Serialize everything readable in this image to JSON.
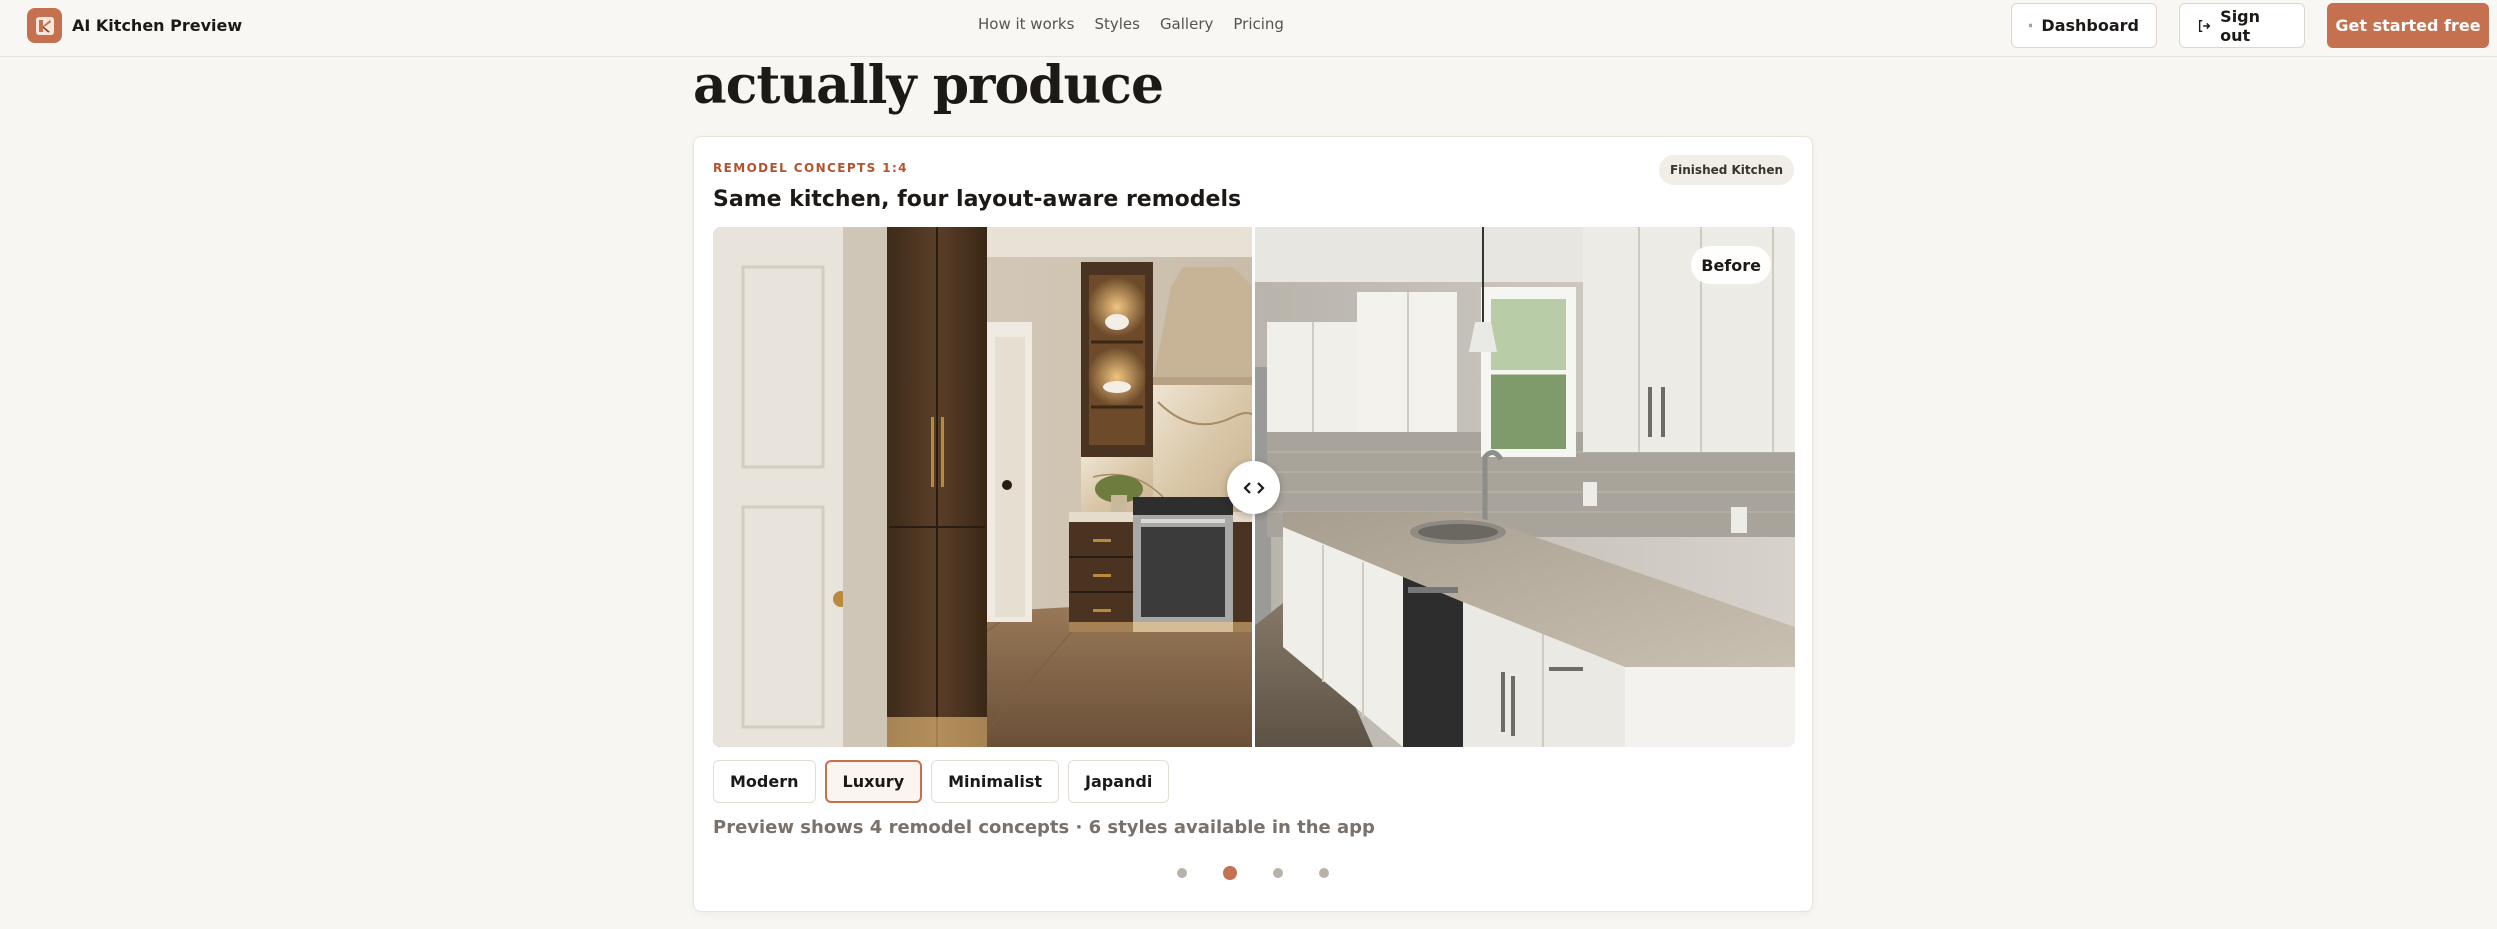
{
  "header": {
    "brand": "AI Kitchen Preview",
    "nav": [
      "How it works",
      "Styles",
      "Gallery",
      "Pricing"
    ],
    "dashboard_label": "Dashboard",
    "signout_label": "Sign out",
    "cta_label": "Get started free"
  },
  "hero": {
    "title": "actually produce"
  },
  "card": {
    "eyebrow": "REMODEL CONCEPTS 1:4",
    "badge": "Finished Kitchen",
    "title": "Same kitchen, four layout-aware remodels",
    "before_label": "Before",
    "styles": [
      "Modern",
      "Luxury",
      "Minimalist",
      "Japandi"
    ],
    "active_style": "Luxury",
    "caption": "Preview shows 4 remodel concepts · 6 styles available in the app",
    "pagination": {
      "total": 4,
      "active": 2
    }
  },
  "colors": {
    "accent": "#c5704f",
    "eyebrow": "#b4522d",
    "background": "#f8f6f2"
  },
  "icons": {
    "logo": "kitchen-logo-icon",
    "dashboard": "grid-icon",
    "signout": "logout-icon",
    "handle": "chevrons-left-right-icon"
  }
}
